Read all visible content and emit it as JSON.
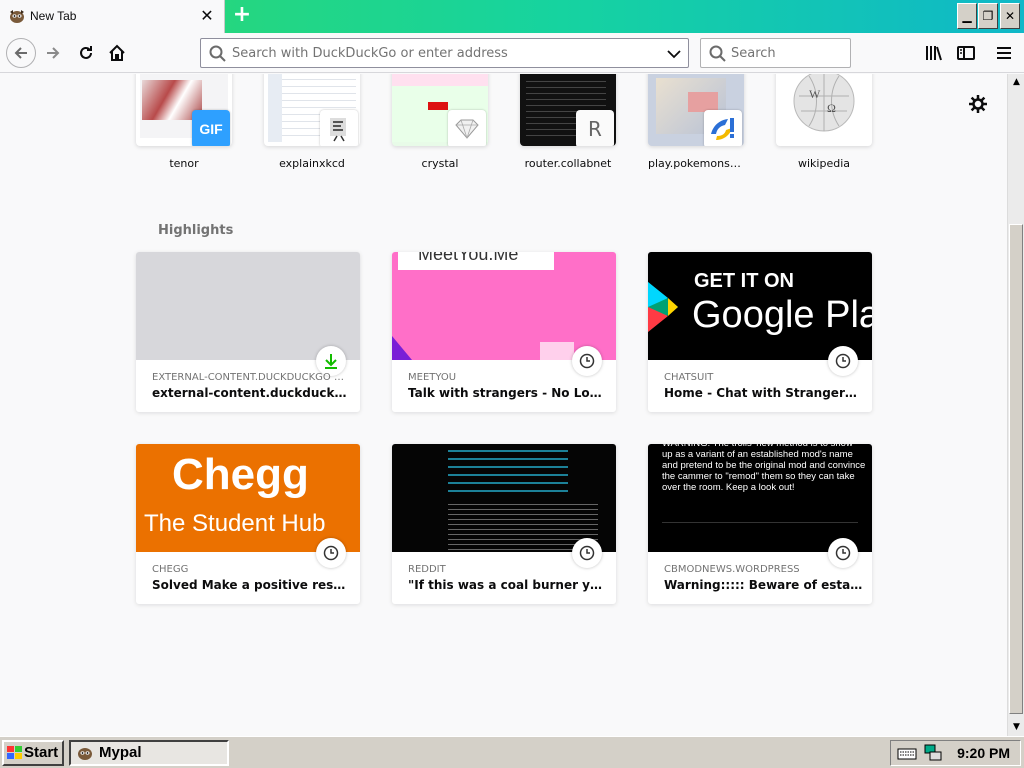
{
  "tab": {
    "title": "New Tab"
  },
  "navbar": {
    "url_placeholder": "Search with DuckDuckGo or enter address",
    "search_placeholder": "Search"
  },
  "top_sites": [
    {
      "label": "tenor",
      "icon": "gif-icon"
    },
    {
      "label": "explainxkcd",
      "icon": "xkcd-icon"
    },
    {
      "label": "crystal",
      "icon": "diamond-icon"
    },
    {
      "label": "router.collabnet",
      "icon": "letter-r-icon",
      "letter": "R"
    },
    {
      "label": "play.pokemonsho...",
      "icon": "showdown-icon"
    },
    {
      "label": "wikipedia",
      "icon": "wikipedia-globe-icon"
    }
  ],
  "highlights": {
    "title": "Highlights",
    "cards": [
      {
        "source": "EXTERNAL-CONTENT.DUCKDUCKGO — 3...",
        "title": "external-content.duckduckgo.c...",
        "badge": "download-icon"
      },
      {
        "source": "MEETYOU",
        "title": "Talk with strangers - No Login - ...",
        "badge": "clock-icon",
        "thumb_text": "MeetYou.Me"
      },
      {
        "source": "CHATSUIT",
        "title": "Home - Chat with Strangers in fr...",
        "badge": "clock-icon",
        "thumb_text_1": "GET IT ON",
        "thumb_text_2": "Google Pla"
      },
      {
        "source": "CHEGG",
        "title": "Solved Make a positive response...",
        "badge": "clock-icon",
        "thumb_text_1": "Chegg",
        "thumb_text_2": "The Student Hub"
      },
      {
        "source": "REDDIT",
        "title": "\"If this was a coal burner you'll fi...",
        "badge": "clock-icon"
      },
      {
        "source": "CBMODNEWS.WORDPRESS",
        "title": "Warning::::: Beware of establishe...",
        "badge": "clock-icon",
        "thumb_text": "WARNING: The trolls' new method is to show up as a variant of an established mod's name and pretend to be the original mod and convince the cammer to \"remod\" them so they can take over the room. Keep a look out!"
      }
    ]
  },
  "taskbar": {
    "start_label": "Start",
    "task_label": "Mypal",
    "clock": "9:20 PM"
  },
  "colors": {
    "tabbar_gradient_start": "#2fd96a",
    "tabbar_gradient_end": "#0fb8c8",
    "chegg_orange": "#eb7100",
    "meetyou_pink": "#ff6fc8"
  }
}
